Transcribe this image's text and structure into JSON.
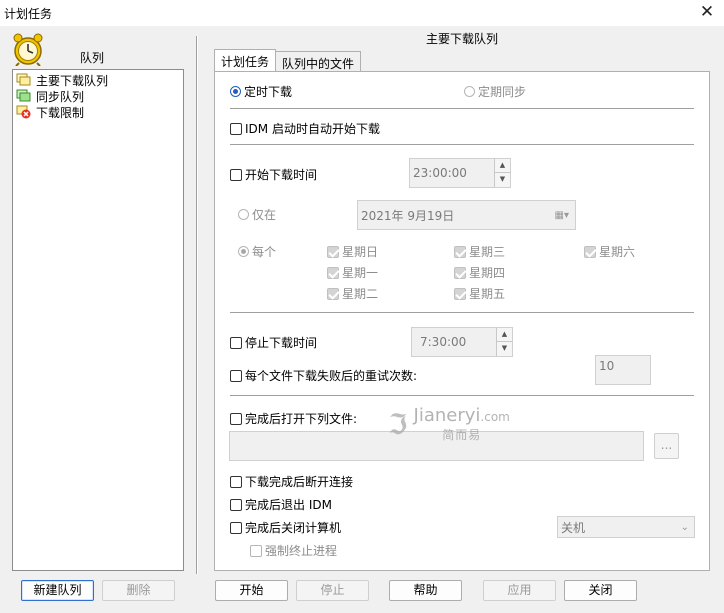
{
  "window": {
    "title": "计划任务"
  },
  "sidebar": {
    "header": "队列",
    "items": [
      {
        "label": "主要下载队列",
        "icon": "main-queue-icon"
      },
      {
        "label": "同步队列",
        "icon": "sync-queue-icon"
      },
      {
        "label": "下载限制",
        "icon": "download-limit-icon"
      }
    ],
    "new_button": "新建队列",
    "delete_button": "删除"
  },
  "queue_title": "主要下载队列",
  "tabs": [
    {
      "label": "计划任务",
      "active": true
    },
    {
      "label": "队列中的文件",
      "active": false
    }
  ],
  "schedule": {
    "mode_scheduled": "定时下载",
    "mode_sync": "定期同步",
    "idm_startup": "IDM 启动时自动开始下载",
    "start_time_label": "开始下载时间",
    "start_time_value": "23:00:00",
    "once_label": "仅在",
    "once_date": "2021年  9月19日",
    "every_label": "每个",
    "weekdays": [
      "星期日",
      "星期一",
      "星期二",
      "星期三",
      "星期四",
      "星期五",
      "星期六"
    ],
    "stop_time_label": "停止下载时间",
    "stop_time_value": "7:30:00",
    "retry_label": "每个文件下载失败后的重试次数:",
    "retry_value": "10",
    "open_file_label": "完成后打开下列文件:",
    "browse_label": "...",
    "disconnect_label": "下载完成后断开连接",
    "exit_idm_label": "完成后退出 IDM",
    "shutdown_label": "完成后关闭计算机",
    "shutdown_option": "关机",
    "force_kill_label": "强制终止进程"
  },
  "footer": {
    "start": "开始",
    "stop": "停止",
    "help": "帮助",
    "apply": "应用",
    "close": "关闭"
  },
  "watermark": {
    "brand": "Jianeryi",
    "domain": ".com",
    "sub": "简而易"
  },
  "colors": {
    "accent": "#1f5fbf",
    "panel": "#ffffff",
    "window_bg": "#f0f0f0"
  }
}
